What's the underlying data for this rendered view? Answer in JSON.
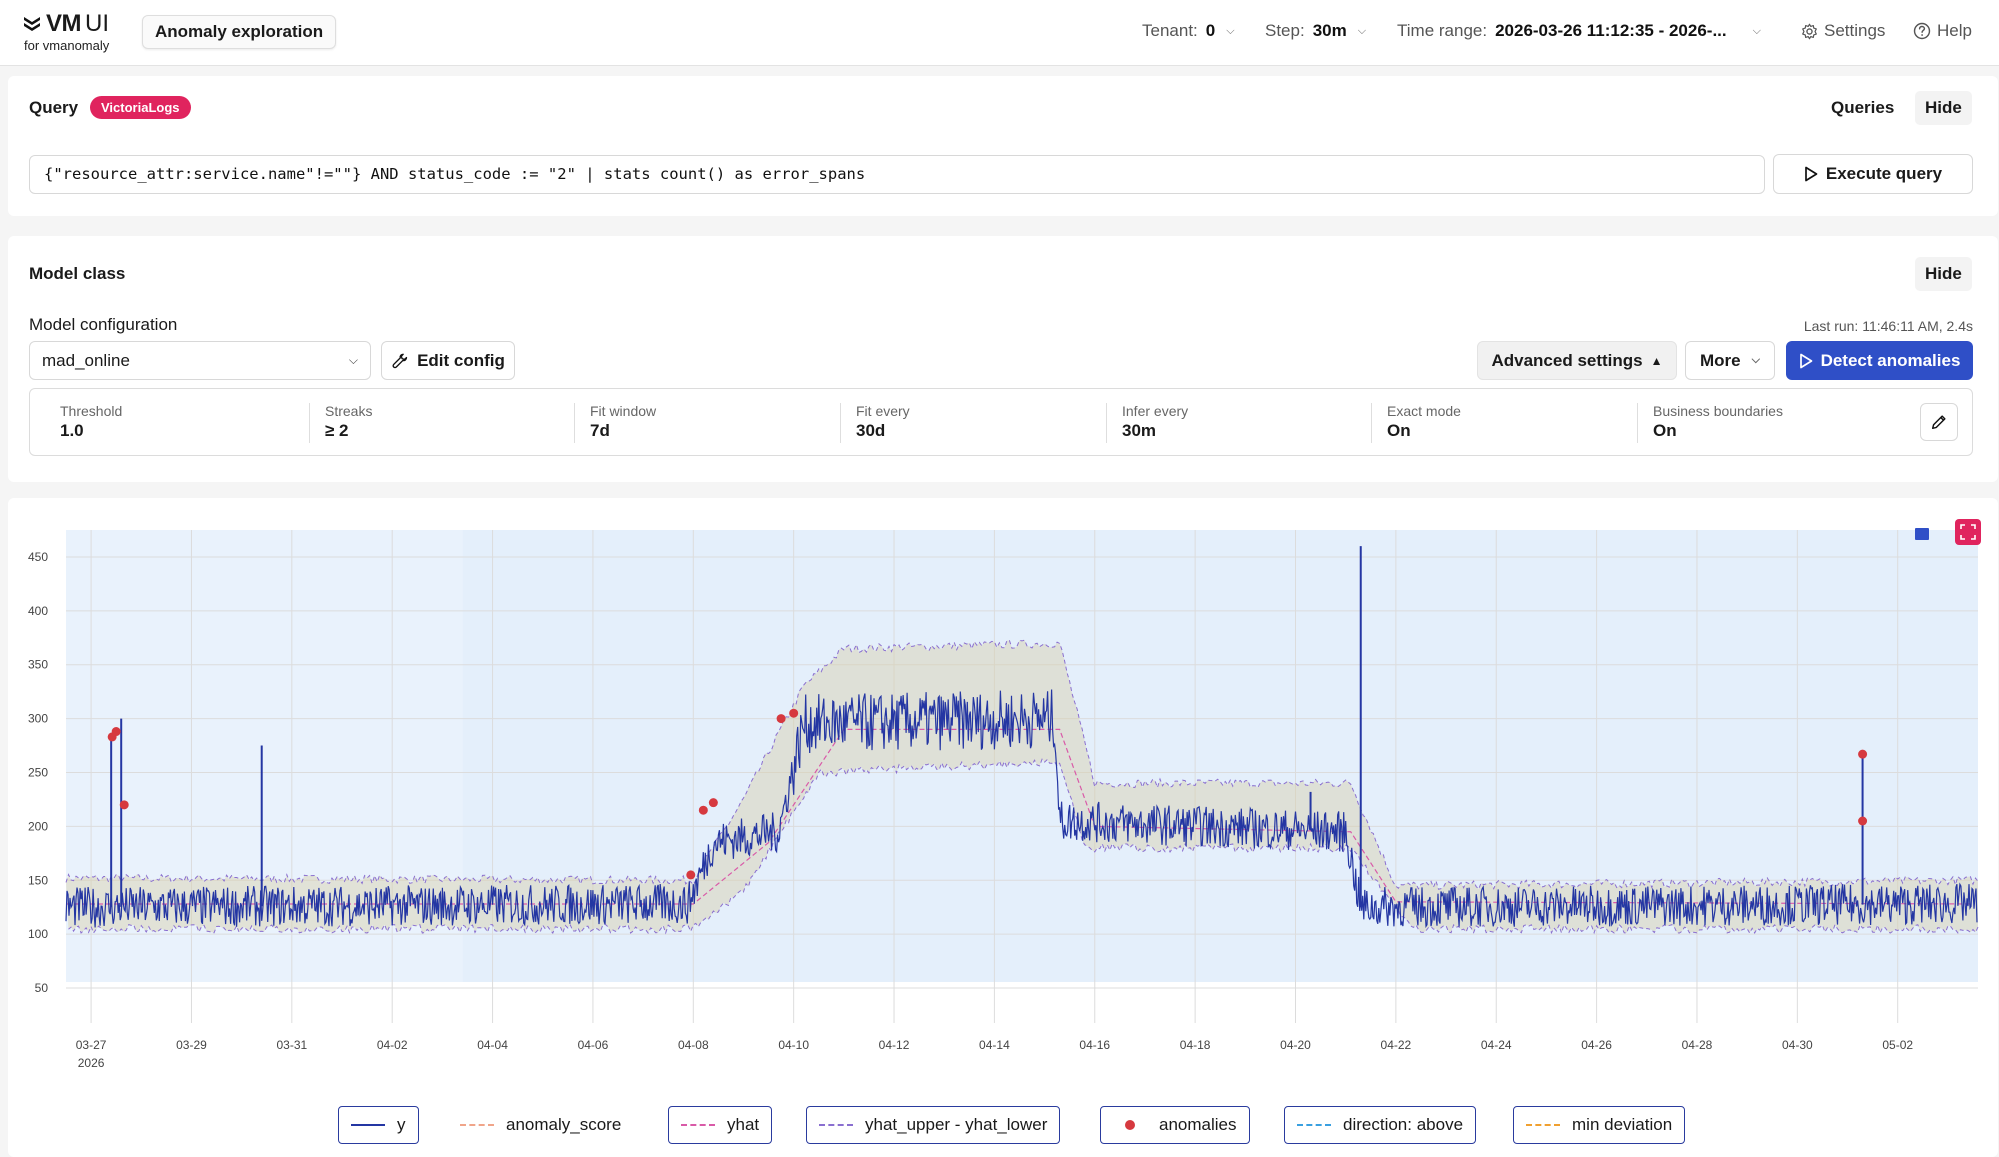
{
  "header": {
    "logo_vm": "VM",
    "logo_ui": "UI",
    "logo_sub": "for vmanomaly",
    "tab_label": "Anomaly exploration",
    "tenant_label": "Tenant:",
    "tenant_value": "0",
    "step_label": "Step:",
    "step_value": "30m",
    "time_range_label": "Time range:",
    "time_range_value": "2026-03-26 11:12:35 - 2026-...",
    "settings_label": "Settings",
    "help_label": "Help"
  },
  "query_panel": {
    "title": "Query",
    "badge": "VictoriaLogs",
    "queries_label": "Queries",
    "hide_label": "Hide",
    "query_text": "{\"resource_attr:service.name\"!=\"\"} AND status_code := \"2\" | stats count() as error_spans",
    "execute_label": "Execute query"
  },
  "model_panel": {
    "title": "Model class",
    "hide_label": "Hide",
    "config_label": "Model configuration",
    "last_run": "Last run: 11:46:11 AM, 2.4s",
    "model_value": "mad_online",
    "edit_config_label": "Edit config",
    "advanced_label": "Advanced settings",
    "more_label": "More",
    "detect_label": "Detect anomalies",
    "params": [
      {
        "label": "Threshold",
        "value": "1.0"
      },
      {
        "label": "Streaks",
        "value": "≥ 2"
      },
      {
        "label": "Fit window",
        "value": "7d"
      },
      {
        "label": "Fit every",
        "value": "30d"
      },
      {
        "label": "Infer every",
        "value": "30m"
      },
      {
        "label": "Exact mode",
        "value": "On"
      },
      {
        "label": "Business boundaries",
        "value": "On"
      }
    ]
  },
  "colors": {
    "y": "#2436a3",
    "anomaly_score": "#f0a58a",
    "yhat": "#d95aa8",
    "band": "#8a6fd0",
    "anomaly": "#d6393f",
    "direction_above": "#3aa0e0",
    "min_deviation": "#f0a030",
    "accent": "#2f4fc7",
    "badge": "#e0245e"
  },
  "chart_data": {
    "type": "line",
    "yticks": [
      50,
      100,
      150,
      200,
      250,
      300,
      350,
      400,
      450
    ],
    "ylim": [
      25,
      475
    ],
    "xlim": [
      -0.5,
      37.6
    ],
    "xticks": [
      {
        "d": 0,
        "label": "03-27",
        "sub": "2026"
      },
      {
        "d": 2,
        "label": "03-29"
      },
      {
        "d": 4,
        "label": "03-31"
      },
      {
        "d": 6,
        "label": "04-02"
      },
      {
        "d": 8,
        "label": "04-04"
      },
      {
        "d": 10,
        "label": "04-06"
      },
      {
        "d": 12,
        "label": "04-08"
      },
      {
        "d": 14,
        "label": "04-10"
      },
      {
        "d": 16,
        "label": "04-12"
      },
      {
        "d": 18,
        "label": "04-14"
      },
      {
        "d": 20,
        "label": "04-16"
      },
      {
        "d": 22,
        "label": "04-18"
      },
      {
        "d": 24,
        "label": "04-20"
      },
      {
        "d": 26,
        "label": "04-22"
      },
      {
        "d": 28,
        "label": "04-24"
      },
      {
        "d": 30,
        "label": "04-26"
      },
      {
        "d": 32,
        "label": "04-28"
      },
      {
        "d": 34,
        "label": "04-30"
      },
      {
        "d": 36,
        "label": "05-02"
      }
    ],
    "shaded_regions": [
      [
        -0.5,
        7.4
      ],
      [
        7.4,
        37.6
      ]
    ],
    "series": [
      {
        "name": "y",
        "levels": [
          [
            -0.5,
            125
          ],
          [
            11.9,
            128
          ],
          [
            12.4,
            185
          ],
          [
            13.7,
            195
          ],
          [
            14.2,
            295
          ],
          [
            19.2,
            300
          ],
          [
            19.3,
            205
          ],
          [
            25.0,
            195
          ],
          [
            25.3,
            125
          ],
          [
            37.6,
            128
          ]
        ],
        "spikes": [
          [
            0.4,
            285
          ],
          [
            0.6,
            300
          ],
          [
            3.4,
            275
          ],
          [
            24.3,
            232
          ],
          [
            25.3,
            460
          ],
          [
            35.3,
            265
          ]
        ]
      },
      {
        "name": "yhat_upper",
        "levels": [
          [
            -0.5,
            152
          ],
          [
            12.0,
            150
          ],
          [
            13.0,
            225
          ],
          [
            14.2,
            330
          ],
          [
            15.0,
            365
          ],
          [
            19.3,
            370
          ],
          [
            20.0,
            240
          ],
          [
            25.1,
            240
          ],
          [
            26.0,
            145
          ],
          [
            37.6,
            150
          ]
        ]
      },
      {
        "name": "yhat_lower",
        "levels": [
          [
            -0.5,
            105
          ],
          [
            12.0,
            105
          ],
          [
            13.0,
            140
          ],
          [
            14.5,
            250
          ],
          [
            19.3,
            260
          ],
          [
            19.8,
            180
          ],
          [
            25.1,
            180
          ],
          [
            26.3,
            105
          ],
          [
            37.6,
            105
          ]
        ]
      },
      {
        "name": "yhat",
        "levels": [
          [
            -0.5,
            128
          ],
          [
            12.0,
            128
          ],
          [
            13.5,
            185
          ],
          [
            15.0,
            290
          ],
          [
            19.3,
            290
          ],
          [
            20.0,
            200
          ],
          [
            25.1,
            195
          ],
          [
            26.0,
            130
          ],
          [
            37.6,
            128
          ]
        ]
      }
    ],
    "anomalies": [
      {
        "x": 0.42,
        "y": 283
      },
      {
        "x": 0.5,
        "y": 288
      },
      {
        "x": 0.66,
        "y": 220
      },
      {
        "x": 11.95,
        "y": 155
      },
      {
        "x": 12.2,
        "y": 215
      },
      {
        "x": 12.4,
        "y": 222
      },
      {
        "x": 13.75,
        "y": 300
      },
      {
        "x": 14.0,
        "y": 305
      },
      {
        "x": 35.3,
        "y": 267
      },
      {
        "x": 35.3,
        "y": 205
      }
    ],
    "legend": [
      {
        "key": "y",
        "label": "y",
        "style": "solid",
        "boxed": true
      },
      {
        "key": "anomaly_score",
        "label": "anomaly_score",
        "style": "dashed",
        "boxed": false
      },
      {
        "key": "yhat",
        "label": "yhat",
        "style": "dashed",
        "boxed": true
      },
      {
        "key": "band",
        "label": "yhat_upper - yhat_lower",
        "style": "dashed",
        "boxed": true
      },
      {
        "key": "anomaly",
        "label": "anomalies",
        "style": "dot",
        "boxed": true
      },
      {
        "key": "direction_above",
        "label": "direction: above",
        "style": "dashed",
        "boxed": true
      },
      {
        "key": "min_deviation",
        "label": "min deviation",
        "style": "dashed",
        "boxed": true
      }
    ]
  }
}
